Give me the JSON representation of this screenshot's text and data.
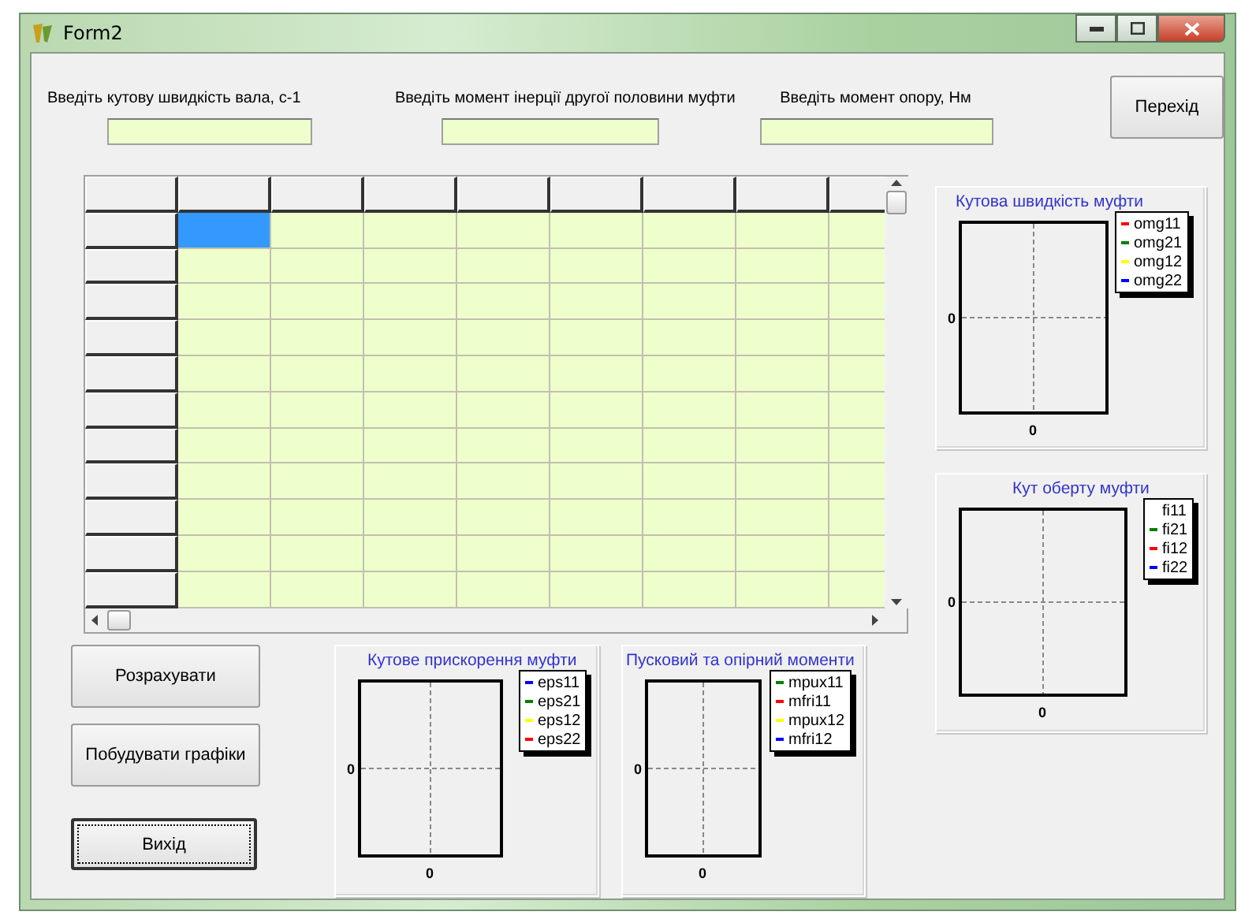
{
  "window": {
    "title": "Form2"
  },
  "inputs": [
    {
      "label": "Введіть кутову швидкість вала, с-1"
    },
    {
      "label": "Введіть момент інерції другої половини муфти"
    },
    {
      "label": "Введіть момент опору, Нм"
    }
  ],
  "transition_button": {
    "label": "Перехід"
  },
  "grid": {
    "rows": [
      {
        "cells": [
          {
            "selected": true
          },
          {
            "selected": false
          },
          {
            "selected": false
          },
          {
            "selected": false
          },
          {
            "selected": false
          },
          {
            "selected": false
          },
          {
            "selected": false
          },
          {
            "selected": false
          }
        ]
      },
      {
        "cells": [
          {
            "selected": false
          },
          {
            "selected": false
          },
          {
            "selected": false
          },
          {
            "selected": false
          },
          {
            "selected": false
          },
          {
            "selected": false
          },
          {
            "selected": false
          },
          {
            "selected": false
          }
        ]
      },
      {
        "cells": [
          {
            "selected": false
          },
          {
            "selected": false
          },
          {
            "selected": false
          },
          {
            "selected": false
          },
          {
            "selected": false
          },
          {
            "selected": false
          },
          {
            "selected": false
          },
          {
            "selected": false
          }
        ]
      },
      {
        "cells": [
          {
            "selected": false
          },
          {
            "selected": false
          },
          {
            "selected": false
          },
          {
            "selected": false
          },
          {
            "selected": false
          },
          {
            "selected": false
          },
          {
            "selected": false
          },
          {
            "selected": false
          }
        ]
      },
      {
        "cells": [
          {
            "selected": false
          },
          {
            "selected": false
          },
          {
            "selected": false
          },
          {
            "selected": false
          },
          {
            "selected": false
          },
          {
            "selected": false
          },
          {
            "selected": false
          },
          {
            "selected": false
          }
        ]
      },
      {
        "cells": [
          {
            "selected": false
          },
          {
            "selected": false
          },
          {
            "selected": false
          },
          {
            "selected": false
          },
          {
            "selected": false
          },
          {
            "selected": false
          },
          {
            "selected": false
          },
          {
            "selected": false
          }
        ]
      },
      {
        "cells": [
          {
            "selected": false
          },
          {
            "selected": false
          },
          {
            "selected": false
          },
          {
            "selected": false
          },
          {
            "selected": false
          },
          {
            "selected": false
          },
          {
            "selected": false
          },
          {
            "selected": false
          }
        ]
      },
      {
        "cells": [
          {
            "selected": false
          },
          {
            "selected": false
          },
          {
            "selected": false
          },
          {
            "selected": false
          },
          {
            "selected": false
          },
          {
            "selected": false
          },
          {
            "selected": false
          },
          {
            "selected": false
          }
        ]
      },
      {
        "cells": [
          {
            "selected": false
          },
          {
            "selected": false
          },
          {
            "selected": false
          },
          {
            "selected": false
          },
          {
            "selected": false
          },
          {
            "selected": false
          },
          {
            "selected": false
          },
          {
            "selected": false
          }
        ]
      },
      {
        "cells": [
          {
            "selected": false
          },
          {
            "selected": false
          },
          {
            "selected": false
          },
          {
            "selected": false
          },
          {
            "selected": false
          },
          {
            "selected": false
          },
          {
            "selected": false
          },
          {
            "selected": false
          }
        ]
      },
      {
        "cells": [
          {
            "selected": false
          },
          {
            "selected": false
          },
          {
            "selected": false
          },
          {
            "selected": false
          },
          {
            "selected": false
          },
          {
            "selected": false
          },
          {
            "selected": false
          },
          {
            "selected": false
          }
        ]
      }
    ]
  },
  "buttons": [
    {
      "label": "Розрахувати",
      "focused": false
    },
    {
      "label": "Побудувати графіки",
      "focused": false
    },
    {
      "label": "Вихід",
      "focused": true
    }
  ],
  "charts": [
    {
      "title": "Кутова швидкість муфти",
      "y_tick": "0",
      "x_tick": "0",
      "legend": [
        {
          "name": "omg11",
          "color": "#ff0000"
        },
        {
          "name": "omg21",
          "color": "#008000"
        },
        {
          "name": "omg12",
          "color": "#ffff00"
        },
        {
          "name": "omg22",
          "color": "#0000ff"
        }
      ]
    },
    {
      "title": "Кут оберту муфти",
      "y_tick": "0",
      "x_tick": "0",
      "legend": [
        {
          "name": "fi11"
        },
        {
          "name": "fi21",
          "color": "#008000"
        },
        {
          "name": "fi12",
          "color": "#ff0000"
        },
        {
          "name": "fi22",
          "color": "#0000ff"
        }
      ]
    },
    {
      "title": "Кутове прискорення муфти",
      "y_tick": "0",
      "x_tick": "0",
      "legend": [
        {
          "name": "eps11",
          "color": "#0000ff"
        },
        {
          "name": "eps21",
          "color": "#008000"
        },
        {
          "name": "eps12",
          "color": "#ffff00"
        },
        {
          "name": "eps22",
          "color": "#ff0000"
        }
      ]
    },
    {
      "title": "Пусковий та опірний моменти",
      "y_tick": "0",
      "x_tick": "0",
      "legend": [
        {
          "name": "mpux11",
          "color": "#008000"
        },
        {
          "name": "mfri11",
          "color": "#ff0000"
        },
        {
          "name": "mpux12",
          "color": "#ffff00"
        },
        {
          "name": "mfri12",
          "color": "#0000ff"
        }
      ]
    }
  ]
}
